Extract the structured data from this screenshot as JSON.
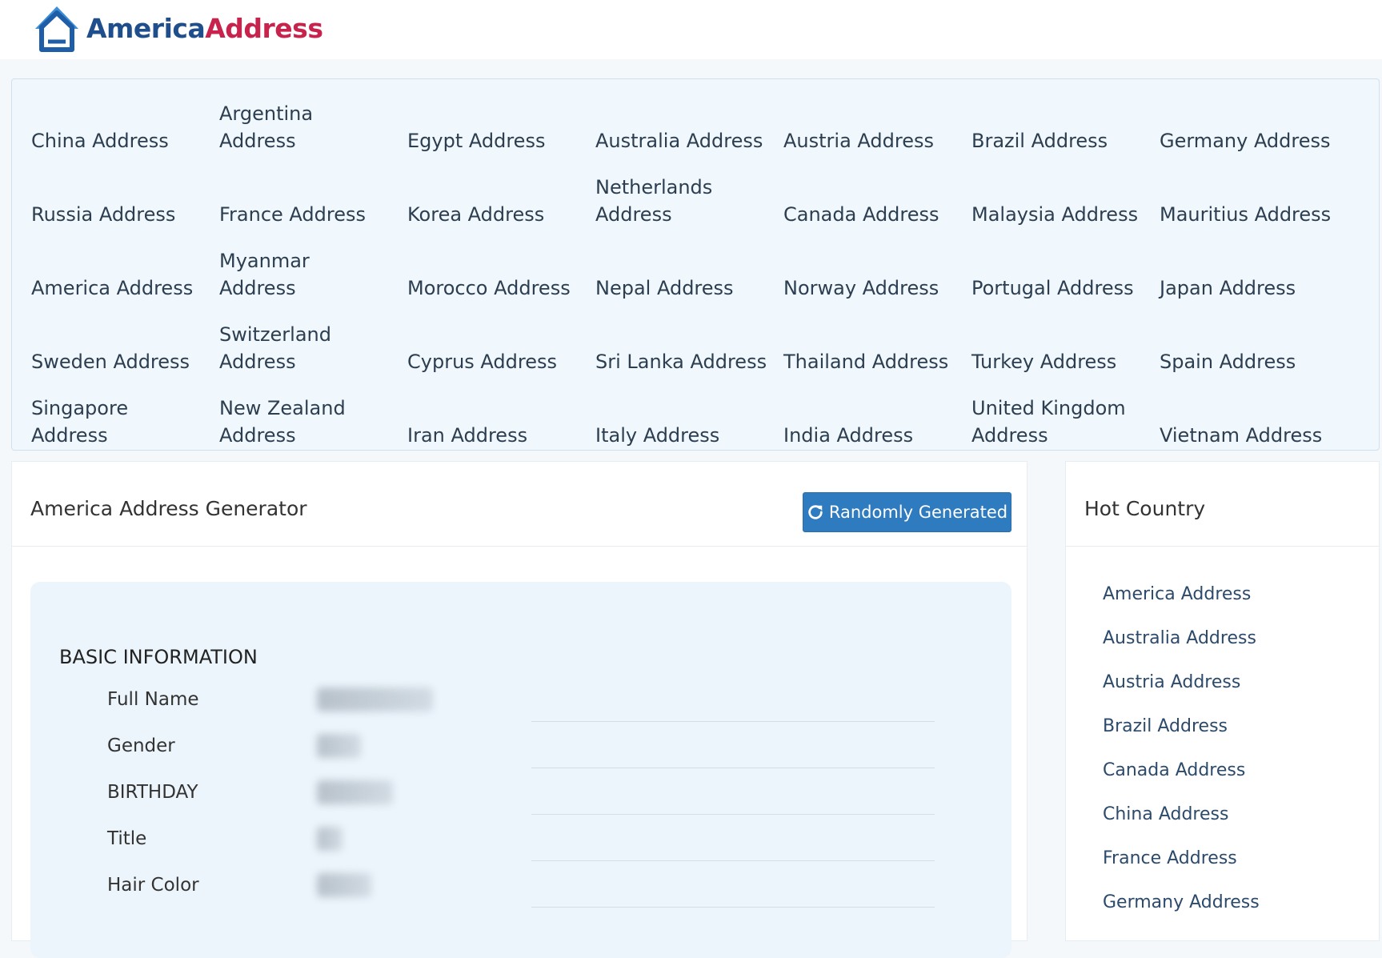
{
  "brand": {
    "part1": "America",
    "part2": "Address",
    "color1": "#1e4f8c",
    "color2": "#c8234c"
  },
  "countries": [
    "China Address",
    "Argentina Address",
    "Egypt Address",
    "Australia Address",
    "Austria Address",
    "Brazil Address",
    "Germany Address",
    "Russia Address",
    "France Address",
    "Korea Address",
    "Netherlands Address",
    "Canada Address",
    "Malaysia Address",
    "Mauritius Address",
    "America Address",
    "Myanmar Address",
    "Morocco Address",
    "Nepal Address",
    "Norway Address",
    "Portugal Address",
    "Japan Address",
    "Sweden Address",
    "Switzerland Address",
    "Cyprus Address",
    "Sri Lanka Address",
    "Thailand Address",
    "Turkey Address",
    "Spain Address",
    "Singapore Address",
    "New Zealand Address",
    "Iran Address",
    "Italy Address",
    "India Address",
    "United Kingdom Address",
    "Vietnam Address"
  ],
  "generator": {
    "title": "America Address Generator",
    "button_label": "Randomly Generated",
    "button_icon": "refresh-icon",
    "section_title": "BASIC INFORMATION",
    "fields": [
      {
        "label": "Full Name"
      },
      {
        "label": "Gender"
      },
      {
        "label": "BIRTHDAY"
      },
      {
        "label": "Title"
      },
      {
        "label": "Hair Color"
      }
    ]
  },
  "hot": {
    "title": "Hot Country",
    "items": [
      "America Address",
      "Australia Address",
      "Austria Address",
      "Brazil Address",
      "Canada Address",
      "China Address",
      "France Address",
      "Germany Address"
    ]
  },
  "colors": {
    "accent": "#2f7bbf",
    "panel_bg": "#f0f7fd",
    "info_bg": "#ecf5fc"
  }
}
